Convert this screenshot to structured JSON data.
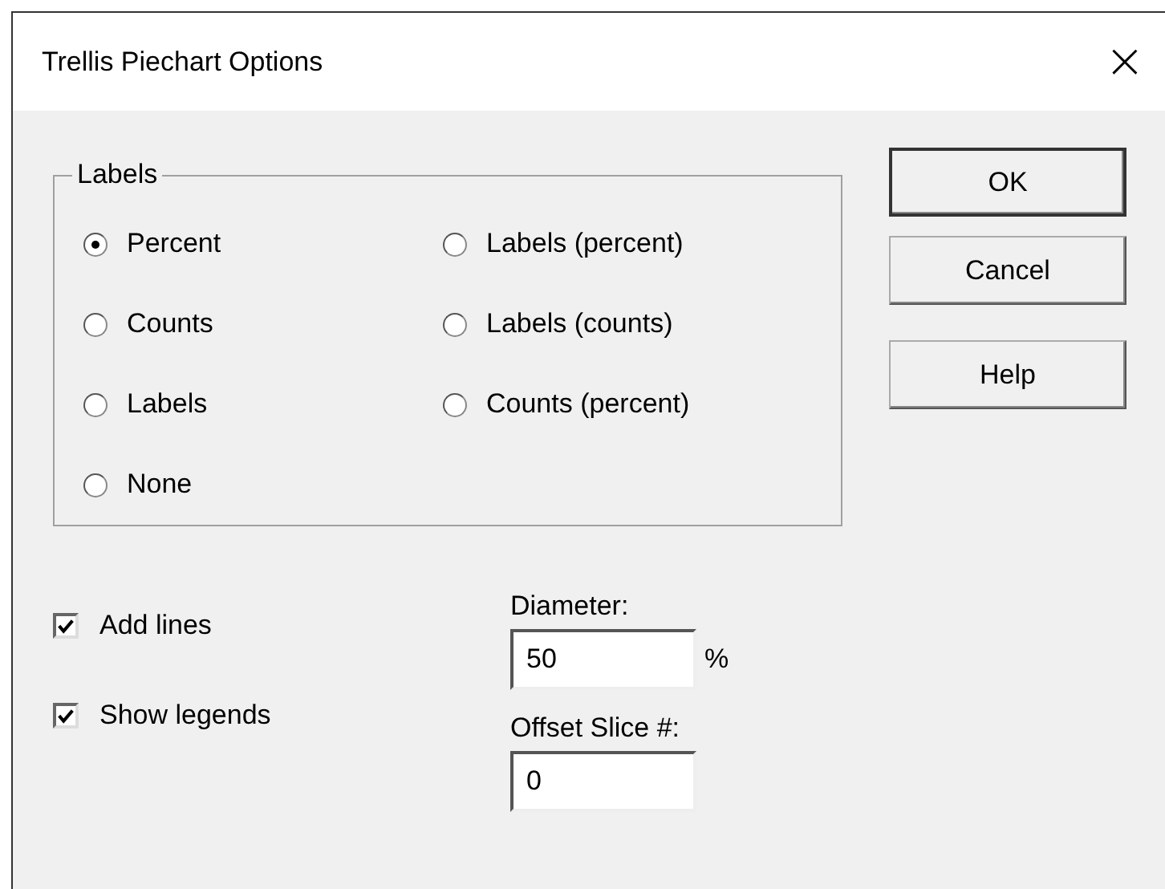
{
  "window": {
    "title": "Trellis Piechart Options",
    "close": "×"
  },
  "labels_group": {
    "title": "Labels",
    "options": [
      {
        "label": "Percent",
        "selected": true
      },
      {
        "label": "Counts",
        "selected": false
      },
      {
        "label": "Labels",
        "selected": false
      },
      {
        "label": "None",
        "selected": false
      },
      {
        "label": "Labels (percent)",
        "selected": false
      },
      {
        "label": "Labels (counts)",
        "selected": false
      },
      {
        "label": "Counts (percent)",
        "selected": false
      }
    ]
  },
  "buttons": [
    {
      "label": "OK",
      "default": true
    },
    {
      "label": "Cancel",
      "default": false
    },
    {
      "label": "Help",
      "default": false
    }
  ],
  "checkboxes": [
    {
      "label": "Add lines",
      "checked": true
    },
    {
      "label": "Show legends",
      "checked": true
    }
  ],
  "diameter": {
    "label": "Diameter:",
    "value": "50",
    "unit": "%"
  },
  "offset_slice": {
    "label": "Offset Slice #:",
    "value": "0"
  }
}
